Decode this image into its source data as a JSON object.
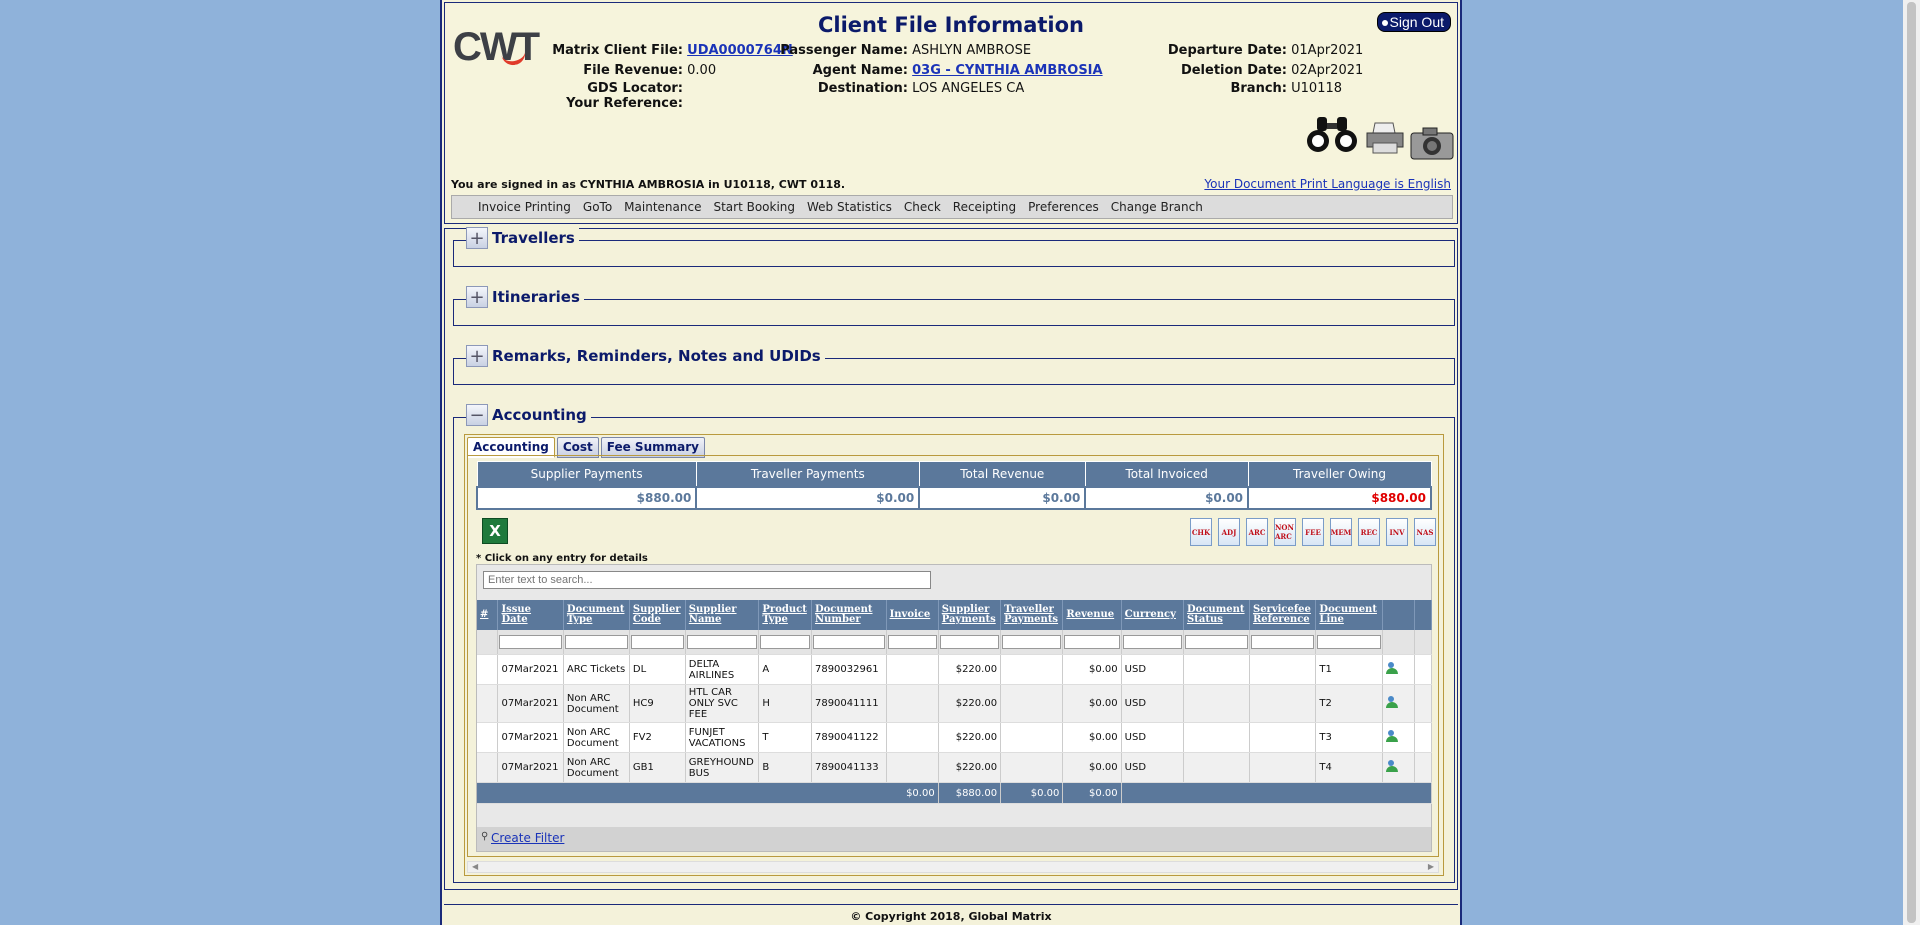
{
  "header": {
    "title": "Client File Information",
    "sign_out": "Sign Out",
    "logo": "CWT",
    "matrix_client_file_label": "Matrix Client File:",
    "matrix_client_file": "UDA0000764N",
    "file_revenue_label": "File Revenue:",
    "file_revenue": "0.00",
    "gds_locator_label": "GDS Locator:",
    "your_reference_label": "Your Reference:",
    "passenger_name_label": "Passenger Name:",
    "passenger_name": "ASHLYN AMBROSE",
    "agent_name_label": "Agent Name:",
    "agent_name": "03G - CYNTHIA AMBROSIA",
    "destination_label": "Destination:",
    "destination": "LOS ANGELES CA",
    "departure_date_label": "Departure Date:",
    "departure_date": "01Apr2021",
    "deletion_date_label": "Deletion Date:",
    "deletion_date": "02Apr2021",
    "branch_label": "Branch:",
    "branch": "U10118",
    "signed_in": "You are signed in as CYNTHIA AMBROSIA in U10118, CWT 0118.",
    "print_language": "Your Document Print Language is English",
    "icons": [
      "binoculars-icon",
      "printer-icon",
      "camera-icon"
    ]
  },
  "menu": [
    "Invoice Printing",
    "GoTo",
    "Maintenance",
    "Start Booking",
    "Web Statistics",
    "Check",
    "Receipting",
    "Preferences",
    "Change Branch"
  ],
  "sections": {
    "travellers": {
      "label": "Travellers",
      "toggle": "+"
    },
    "itineraries": {
      "label": "Itineraries",
      "toggle": "+"
    },
    "remarks": {
      "label": "Remarks, Reminders, Notes and UDIDs",
      "toggle": "+"
    },
    "accounting": {
      "label": "Accounting",
      "toggle": "−"
    }
  },
  "tabs": [
    "Accounting",
    "Cost",
    "Fee Summary"
  ],
  "summary": {
    "headers": [
      "Supplier Payments",
      "Traveller Payments",
      "Total Revenue",
      "Total Invoiced",
      "Traveller Owing"
    ],
    "values": [
      "$880.00",
      "$0.00",
      "$0.00",
      "$0.00",
      "$880.00"
    ]
  },
  "doc_buttons": [
    "CHK",
    "ADJ",
    "ARC",
    "NON ARC",
    "FEE",
    "MEM",
    "REC",
    "INV",
    "NAS"
  ],
  "click_note": "* Click on any entry for details",
  "search_placeholder": "Enter text to search...",
  "grid": {
    "columns": [
      "#",
      "Issue Date",
      "Document Type",
      "Supplier Code",
      "Supplier Name",
      "Product Type",
      "Document Number",
      "Invoice",
      "Supplier Payments",
      "Traveller Payments",
      "Revenue",
      "Currency",
      "Document Status",
      "Servicefee Reference",
      "Document Line"
    ],
    "rows": [
      {
        "issue_date": "07Mar2021",
        "doc_type": "ARC Tickets",
        "supplier_code": "DL",
        "supplier_name": "DELTA AIRLINES",
        "product_type": "A",
        "doc_number": "7890032961",
        "invoice": "",
        "supplier_payments": "$220.00",
        "traveller_payments": "",
        "revenue": "$0.00",
        "currency": "USD",
        "doc_status": "",
        "servicefee_ref": "",
        "doc_line": "T1"
      },
      {
        "issue_date": "07Mar2021",
        "doc_type": "Non ARC Document",
        "supplier_code": "HC9",
        "supplier_name": "HTL CAR ONLY SVC FEE",
        "product_type": "H",
        "doc_number": "7890041111",
        "invoice": "",
        "supplier_payments": "$220.00",
        "traveller_payments": "",
        "revenue": "$0.00",
        "currency": "USD",
        "doc_status": "",
        "servicefee_ref": "",
        "doc_line": "T2"
      },
      {
        "issue_date": "07Mar2021",
        "doc_type": "Non ARC Document",
        "supplier_code": "FV2",
        "supplier_name": "FUNJET VACATIONS",
        "product_type": "T",
        "doc_number": "7890041122",
        "invoice": "",
        "supplier_payments": "$220.00",
        "traveller_payments": "",
        "revenue": "$0.00",
        "currency": "USD",
        "doc_status": "",
        "servicefee_ref": "",
        "doc_line": "T3"
      },
      {
        "issue_date": "07Mar2021",
        "doc_type": "Non ARC Document",
        "supplier_code": "GB1",
        "supplier_name": "GREYHOUND BUS",
        "product_type": "B",
        "doc_number": "7890041133",
        "invoice": "",
        "supplier_payments": "$220.00",
        "traveller_payments": "",
        "revenue": "$0.00",
        "currency": "USD",
        "doc_status": "",
        "servicefee_ref": "",
        "doc_line": "T4"
      }
    ],
    "totals": {
      "invoice": "$0.00",
      "supplier_payments": "$880.00",
      "traveller_payments": "$0.00",
      "revenue": "$0.00"
    }
  },
  "create_filter": "Create Filter",
  "footer": "© Copyright 2018, Global Matrix",
  "colors": {
    "header_blue": "#5b789b",
    "navy": "#0b1a6a",
    "owing_red": "#e00000",
    "background": "#f4f2da"
  }
}
